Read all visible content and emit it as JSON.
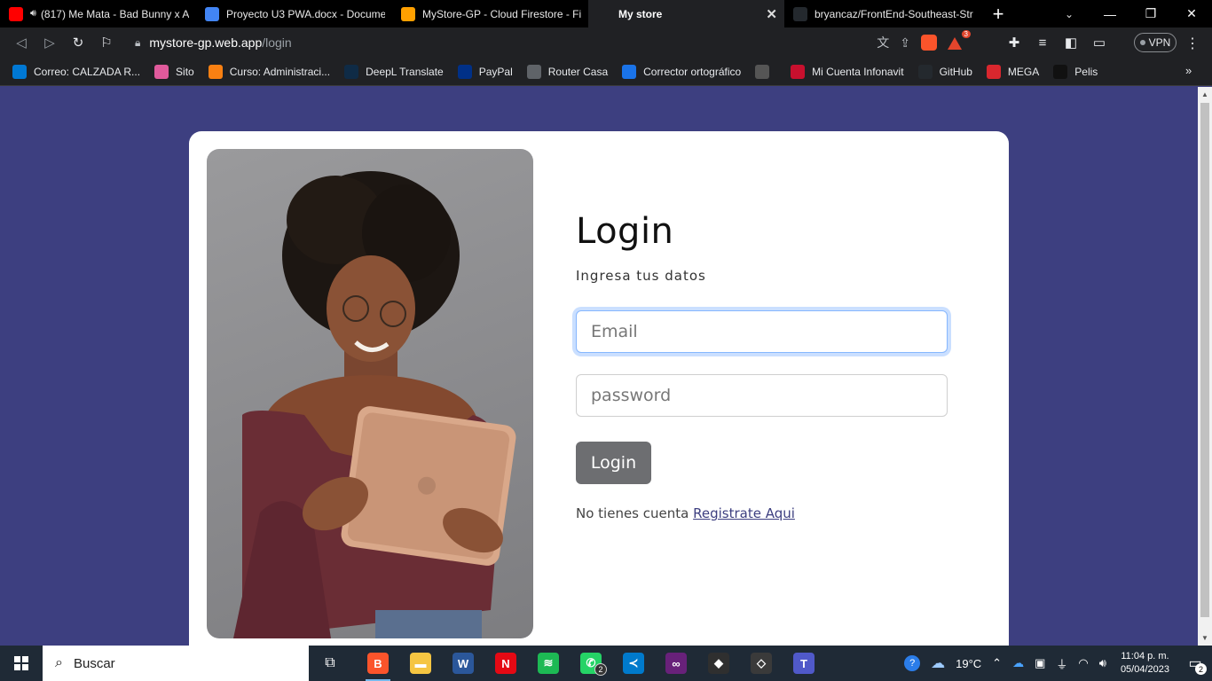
{
  "browser": {
    "tabs": [
      {
        "title": "(817) Me Mata - Bad Bunny x A",
        "favicon": "youtube-icon",
        "color": "#ff0000",
        "audio": true
      },
      {
        "title": "Proyecto U3 PWA.docx - Documen",
        "favicon": "google-docs-icon",
        "color": "#4285f4"
      },
      {
        "title": "MyStore-GP - Cloud Firestore - Fir",
        "favicon": "firebase-icon",
        "color": "#ffa000"
      },
      {
        "title": "My store",
        "favicon": "angular-icon",
        "color": "#202124",
        "active": true
      },
      {
        "title": "bryancaz/FrontEnd-Southeast-Stre",
        "favicon": "github-icon",
        "color": "#24292e"
      }
    ],
    "url_host": "mystore-gp.web.app",
    "url_path": "/login",
    "vpn_label": "VPN",
    "rewards_count": "3",
    "bookmarks": [
      {
        "label": "Correo: CALZADA R...",
        "icon": "outlook-icon",
        "color": "#0078d4"
      },
      {
        "label": "Sito",
        "icon": "sito-icon",
        "color": "#e05a9c"
      },
      {
        "label": "Curso: Administraci...",
        "icon": "moodle-icon",
        "color": "#f98012"
      },
      {
        "label": "DeepL Translate",
        "icon": "deepl-icon",
        "color": "#0f2b46"
      },
      {
        "label": "PayPal",
        "icon": "paypal-icon",
        "color": "#003087"
      },
      {
        "label": "Router Casa",
        "icon": "globe-icon",
        "color": "#5f6368"
      },
      {
        "label": "Corrector ortográfico",
        "icon": "corrector-icon",
        "color": "#1a73e8"
      },
      {
        "label": "",
        "icon": "pixel-icon",
        "color": "#555555"
      },
      {
        "label": "Mi Cuenta Infonavit",
        "icon": "infonavit-icon",
        "color": "#c8102e"
      },
      {
        "label": "GitHub",
        "icon": "github-icon",
        "color": "#24292e"
      },
      {
        "label": "MEGA",
        "icon": "mega-icon",
        "color": "#d9272e"
      },
      {
        "label": "Pelis",
        "icon": "pelis-icon",
        "color": "#111111"
      }
    ]
  },
  "login": {
    "title": "Login",
    "subtitle": "Ingresa tus datos",
    "email_placeholder": "Email",
    "password_placeholder": "password",
    "button_label": "Login",
    "register_text": "No tienes cuenta",
    "register_link": "Registrate Aqui"
  },
  "colors": {
    "page_bg": "#3d3f80",
    "button_bg": "#6d6e71",
    "link": "#3d3f80"
  },
  "taskbar": {
    "search_placeholder": "Buscar",
    "apps": [
      {
        "name": "brave-icon",
        "color": "#fb542b",
        "glyph": "B",
        "running": true
      },
      {
        "name": "file-explorer-icon",
        "color": "#f5c542",
        "glyph": "▬"
      },
      {
        "name": "word-icon",
        "color": "#2b579a",
        "glyph": "W"
      },
      {
        "name": "netflix-icon",
        "color": "#e50914",
        "glyph": "N"
      },
      {
        "name": "spotify-icon",
        "color": "#1db954",
        "glyph": "≋"
      },
      {
        "name": "whatsapp-icon",
        "color": "#25d366",
        "glyph": "✆",
        "badge": "2"
      },
      {
        "name": "vscode-icon",
        "color": "#007acc",
        "glyph": "≺"
      },
      {
        "name": "visual-studio-icon",
        "color": "#68217a",
        "glyph": "∞"
      },
      {
        "name": "app-icon",
        "color": "#2f2f2f",
        "glyph": "◆"
      },
      {
        "name": "unity-icon",
        "color": "#3a3a3a",
        "glyph": "◇"
      },
      {
        "name": "teams-icon",
        "color": "#5059c9",
        "glyph": "T"
      }
    ],
    "temperature": "19°C",
    "time": "11:04 p. m.",
    "date": "05/04/2023",
    "notifications": "2"
  }
}
